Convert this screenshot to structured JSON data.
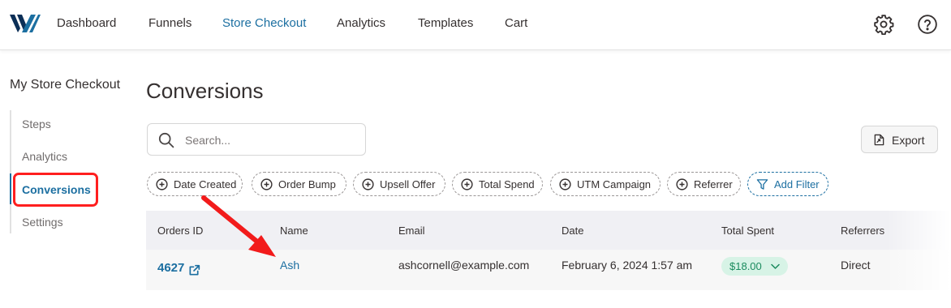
{
  "header": {
    "nav": [
      "Dashboard",
      "Funnels",
      "Store Checkout",
      "Analytics",
      "Templates",
      "Cart"
    ],
    "active_nav": "Store Checkout",
    "icons": [
      "settings-gear-icon",
      "help-question-icon"
    ]
  },
  "sidebar": {
    "title": "My Store Checkout",
    "items": [
      "Steps",
      "Analytics",
      "Conversions",
      "Settings"
    ],
    "active": "Conversions"
  },
  "main": {
    "title": "Conversions",
    "search": {
      "placeholder": "Search..."
    },
    "export_label": "Export",
    "filters": [
      "Date Created",
      "Order Bump",
      "Upsell Offer",
      "Total Spend",
      "UTM Campaign",
      "Referrer"
    ],
    "add_filter_label": "Add Filter",
    "table": {
      "columns": [
        "Orders ID",
        "Name",
        "Email",
        "Date",
        "Total Spent",
        "Referrers"
      ],
      "rows": [
        {
          "order_id": "4627",
          "name": "Ash",
          "email": "ashcornell@example.com",
          "date": "February 6, 2024 1:57 am",
          "total_spent": "$18.00",
          "referrer": "Direct"
        }
      ]
    }
  },
  "colors": {
    "accent": "#1c6fa1",
    "annotation": "#ff1f1f",
    "badge_bg": "#d7f3e6",
    "badge_text": "#1b8b5e"
  }
}
